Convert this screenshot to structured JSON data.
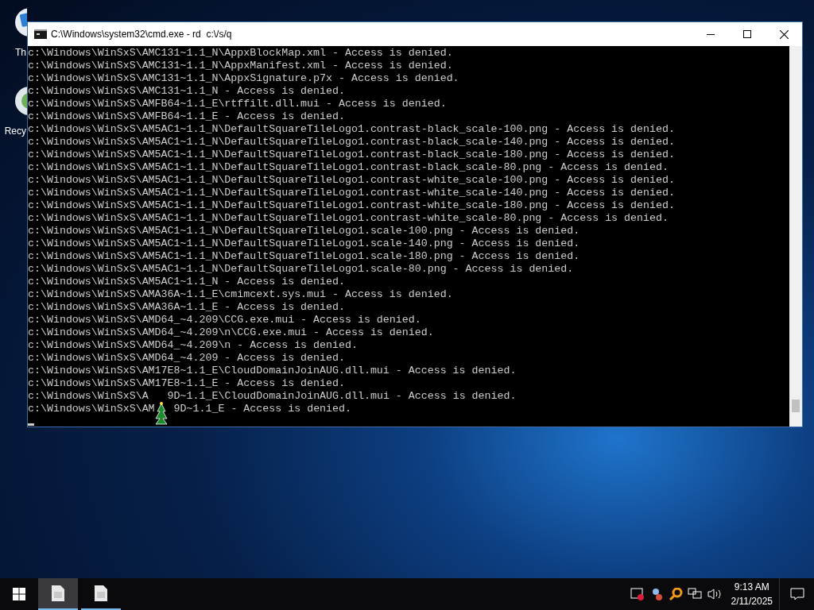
{
  "desktop": {
    "icons": [
      {
        "label": "Th",
        "kind": "computer"
      },
      {
        "label": "Recy",
        "kind": "recycle"
      }
    ]
  },
  "window": {
    "title": "C:\\Windows\\system32\\cmd.exe - rd  c:\\/s/q"
  },
  "console": {
    "lines": [
      {
        "parts": [
          "c:\\Windows\\WinSxS\\AMC131~1.1_N\\AppxBlockMap.xml - Access is denied."
        ]
      },
      {
        "parts": [
          "c:\\Windows\\WinSxS\\AMC131~1.1_N\\AppxManifest.xml - Access is denied."
        ]
      },
      {
        "parts": [
          "c:\\Windows\\WinSxS\\AMC131~1.1_N\\AppxSignature.p7x - Access is denied."
        ]
      },
      {
        "parts": [
          "c:\\Windows\\WinSxS\\AMC131~1.1_N - Access is denied."
        ]
      },
      {
        "parts": [
          "c:\\Windows\\WinSxS\\AMFB64~1.1_E\\rtffilt.dll.mui - Access is denied."
        ]
      },
      {
        "parts": [
          "c:\\Windows\\WinSxS\\AMFB64~1.1_E - Access is denied."
        ]
      },
      {
        "parts": [
          "c:\\Windows\\WinSxS\\AM5AC1~1.1_N\\DefaultSquareTileLogo1.contrast-black_scale-100.png - Access is denied."
        ]
      },
      {
        "parts": [
          "c:\\Windows\\WinSxS\\AM5AC1~1.1_N\\DefaultSquareTileLogo1.contrast-black_scale-140.png - Access is denied."
        ]
      },
      {
        "parts": [
          "c:\\Windows\\WinSxS\\AM5AC1~1.1_N\\DefaultSquareTileLogo1.contrast-black_scale-180.png - Access is denied."
        ]
      },
      {
        "parts": [
          "c:\\Windows\\WinSxS\\AM5AC1~1.1_N\\DefaultSquareTileLogo1.contrast-black_scale-80.png - Access is denied."
        ]
      },
      {
        "parts": [
          "c:\\Windows\\WinSxS\\AM5AC1~1.1_N\\DefaultSquareTileLogo1.contrast-white_scale-100.png - Access is denied."
        ]
      },
      {
        "parts": [
          "c:\\Windows\\WinSxS\\AM5AC1~1.1_N\\DefaultSquareTileLogo1.contrast-white_scale-140.png - Access is denied."
        ]
      },
      {
        "parts": [
          "c:\\Windows\\WinSxS\\AM5AC1~1.1_N\\DefaultSquareTileLogo1.contrast-white_scale-180.png - Access is denied."
        ]
      },
      {
        "parts": [
          "c:\\Windows\\WinSxS\\AM5AC1~1.1_N\\DefaultSquareTileLogo1.contrast-white_scale-80.png - Access is denied."
        ]
      },
      {
        "parts": [
          "c:\\Windows\\WinSxS\\AM5AC1~1.1_N\\DefaultSquareTileLogo1.scale-100.png - Access is denied."
        ]
      },
      {
        "parts": [
          "c:\\Windows\\WinSxS\\AM5AC1~1.1_N\\DefaultSquareTileLogo1.scale-140.png - Access is denied."
        ]
      },
      {
        "parts": [
          "c:\\Windows\\WinSxS\\AM5AC1~1.1_N\\DefaultSquareTileLogo1.scale-180.png - Access is denied."
        ]
      },
      {
        "parts": [
          "c:\\Windows\\WinSxS\\AM5AC1~1.1_N\\DefaultSquareTileLogo1.scale-80.png - Access is denied."
        ]
      },
      {
        "parts": [
          "c:\\Windows\\WinSxS\\AM5AC1~1.1_N - Access is denied."
        ]
      },
      {
        "parts": [
          "c:\\Windows\\WinSxS\\AMA36A~1.1_E\\cmimcext.sys.mui - Access is denied."
        ]
      },
      {
        "parts": [
          "c:\\Windows\\WinSxS\\AMA36A~1.1_E - Access is denied."
        ]
      },
      {
        "parts": [
          "c:\\Windows\\WinSxS\\AMD64_~4.209\\CCG.exe.mui - Access is denied."
        ]
      },
      {
        "parts": [
          "c:\\Windows\\WinSxS\\AMD64_~4.209\\n\\CCG.exe.mui - Access is denied."
        ]
      },
      {
        "parts": [
          "c:\\Windows\\WinSxS\\AMD64_~4.209\\n - Access is denied."
        ]
      },
      {
        "parts": [
          "c:\\Windows\\WinSxS\\AMD64_~4.209 - Access is denied."
        ]
      },
      {
        "parts": [
          "c:\\Windows\\WinSxS\\AM17E8~1.1_E\\CloudDomainJoinAUG.dll.mui - Access is denied."
        ]
      },
      {
        "parts": [
          "c:\\Windows\\WinSxS\\AM17E8~1.1_E - Access is denied."
        ]
      },
      {
        "parts": [
          "c:\\Windows\\WinSxS\\A",
          "9D~1.1_E\\CloudDomainJoinAUG.dll.mui - Access is denied."
        ]
      },
      {
        "parts": [
          "c:\\Windows\\WinSxS\\AM",
          "9D~1.1_E - Access is denied."
        ]
      }
    ]
  },
  "taskbar": {
    "apps": [
      {
        "selected": true
      },
      {
        "selected": false
      }
    ],
    "tray": {
      "time": "9:13 AM",
      "date": "2/11/2025"
    }
  }
}
